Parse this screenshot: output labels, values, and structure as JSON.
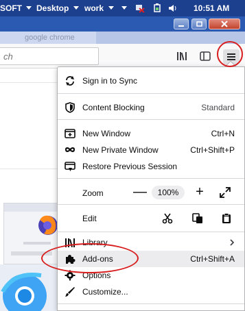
{
  "taskbar": {
    "items": [
      "SOFT",
      "Desktop",
      "work"
    ],
    "time": "10:51 AM"
  },
  "tab": {
    "title": "google chrome"
  },
  "urlbar": {
    "placeholder": "ch"
  },
  "menu": {
    "sync": "Sign in to Sync",
    "content_blocking": "Content Blocking",
    "content_blocking_status": "Standard",
    "new_window": "New Window",
    "new_window_shortcut": "Ctrl+N",
    "private_window": "New Private Window",
    "private_window_shortcut": "Ctrl+Shift+P",
    "restore_session": "Restore Previous Session",
    "zoom_label": "Zoom",
    "zoom_minus": "—",
    "zoom_value": "100%",
    "zoom_plus": "+",
    "edit_label": "Edit",
    "library": "Library",
    "addons": "Add-ons",
    "addons_shortcut": "Ctrl+Shift+A",
    "options": "Options",
    "customize": "Customize..."
  },
  "colors": {
    "taskbar": "#1c3f8e",
    "annotation": "#d81e1e",
    "hover": "#ececee"
  },
  "icons": [
    "sync-icon",
    "shield-icon",
    "new-window-icon",
    "mask-icon",
    "restore-icon",
    "fullscreen-icon",
    "cut-icon",
    "copy-icon",
    "paste-icon",
    "library-icon",
    "puzzle-icon",
    "gear-icon",
    "brush-icon",
    "hamburger-icon",
    "bookshelf-icon",
    "sidebar-icon"
  ]
}
